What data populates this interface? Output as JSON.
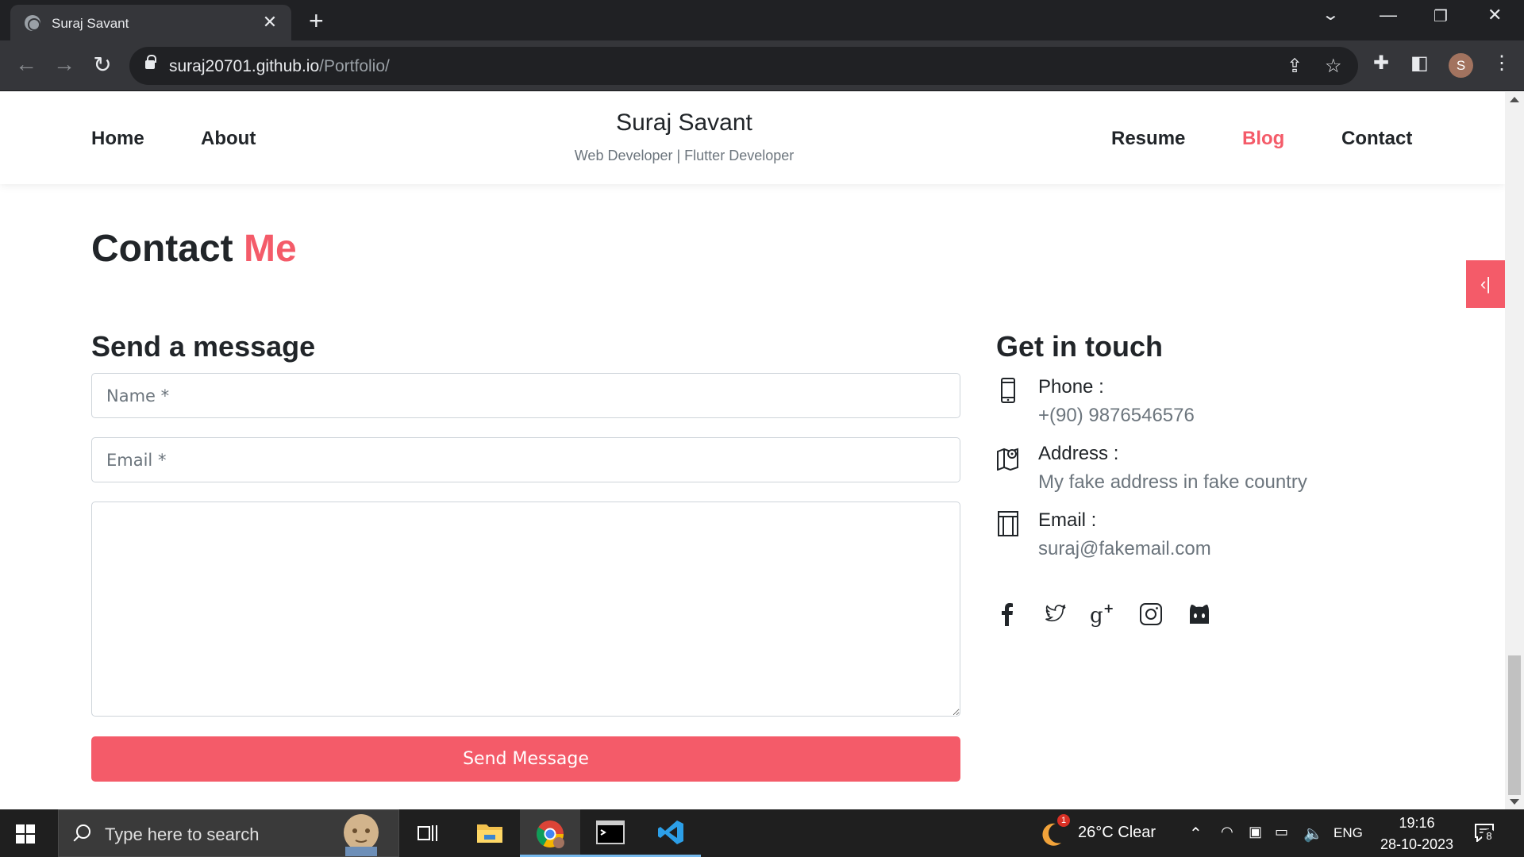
{
  "browser": {
    "tab_title": "Suraj Savant",
    "url_host": "suraj20701.github.io",
    "url_path": "/Portfolio/",
    "profile_initial": "S"
  },
  "site": {
    "brand_name": "Suraj Savant",
    "brand_tagline": "Web Developer | Flutter Developer",
    "nav": {
      "home": "Home",
      "about": "About",
      "resume": "Resume",
      "blog": "Blog",
      "contact": "Contact"
    },
    "active_nav": "Blog",
    "accent_color": "#f45b69"
  },
  "contact": {
    "title_main": "Contact",
    "title_accent": "Me",
    "form": {
      "heading": "Send a message",
      "name_placeholder": "Name *",
      "email_placeholder": "Email *",
      "message_value": "",
      "submit_label": "Send Message"
    },
    "info": {
      "heading": "Get in touch",
      "phone_label": "Phone :",
      "phone_value": "+(90) 9876546576",
      "address_label": "Address :",
      "address_value": "My fake address in fake country",
      "email_label": "Email :",
      "email_value": "suraj@fakemail.com"
    },
    "socials": [
      "facebook-icon",
      "twitter-icon",
      "google-plus-icon",
      "instagram-icon",
      "github-icon"
    ]
  },
  "taskbar": {
    "search_placeholder": "Type here to search",
    "weather": "26°C  Clear",
    "weather_badge": "1",
    "language": "ENG",
    "time": "19:16",
    "date": "28-10-2023",
    "notification_count": "8"
  }
}
